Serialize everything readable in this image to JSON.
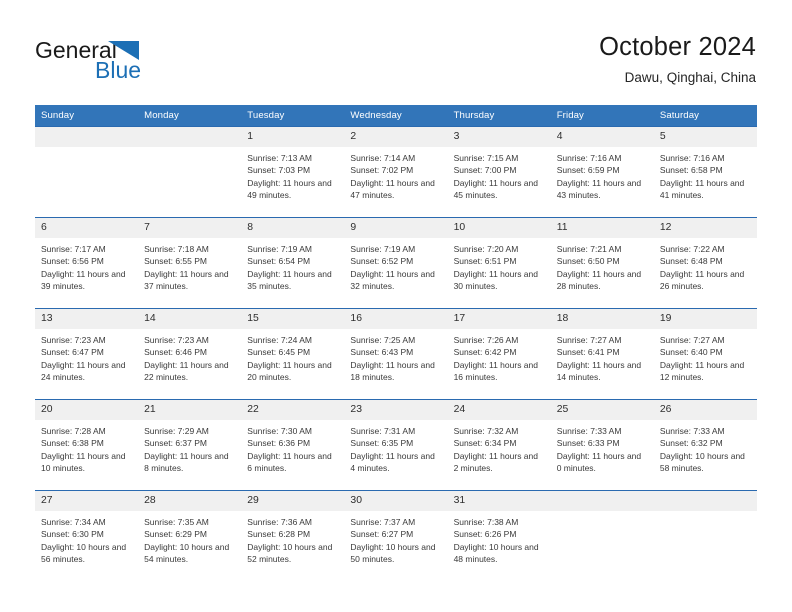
{
  "brand": {
    "name_part1": "General",
    "name_part2": "Blue",
    "logo_icon": "triangle-flag-icon",
    "color_primary": "#1c6fb5",
    "color_text": "#1a1a1a"
  },
  "header": {
    "title": "October 2024",
    "location": "Dawu, Qinghai, China"
  },
  "calendar": {
    "accent_color": "#3275b9",
    "separator_color": "#2a6ab0",
    "daynum_background": "#f0f0f0",
    "weekday_headers": [
      "Sunday",
      "Monday",
      "Tuesday",
      "Wednesday",
      "Thursday",
      "Friday",
      "Saturday"
    ],
    "weeks": [
      [
        {
          "day": "",
          "empty": true
        },
        {
          "day": "",
          "empty": true
        },
        {
          "day": "1",
          "sunrise": "Sunrise: 7:13 AM",
          "sunset": "Sunset: 7:03 PM",
          "daylight": "Daylight: 11 hours and 49 minutes."
        },
        {
          "day": "2",
          "sunrise": "Sunrise: 7:14 AM",
          "sunset": "Sunset: 7:02 PM",
          "daylight": "Daylight: 11 hours and 47 minutes."
        },
        {
          "day": "3",
          "sunrise": "Sunrise: 7:15 AM",
          "sunset": "Sunset: 7:00 PM",
          "daylight": "Daylight: 11 hours and 45 minutes."
        },
        {
          "day": "4",
          "sunrise": "Sunrise: 7:16 AM",
          "sunset": "Sunset: 6:59 PM",
          "daylight": "Daylight: 11 hours and 43 minutes."
        },
        {
          "day": "5",
          "sunrise": "Sunrise: 7:16 AM",
          "sunset": "Sunset: 6:58 PM",
          "daylight": "Daylight: 11 hours and 41 minutes."
        }
      ],
      [
        {
          "day": "6",
          "sunrise": "Sunrise: 7:17 AM",
          "sunset": "Sunset: 6:56 PM",
          "daylight": "Daylight: 11 hours and 39 minutes."
        },
        {
          "day": "7",
          "sunrise": "Sunrise: 7:18 AM",
          "sunset": "Sunset: 6:55 PM",
          "daylight": "Daylight: 11 hours and 37 minutes."
        },
        {
          "day": "8",
          "sunrise": "Sunrise: 7:19 AM",
          "sunset": "Sunset: 6:54 PM",
          "daylight": "Daylight: 11 hours and 35 minutes."
        },
        {
          "day": "9",
          "sunrise": "Sunrise: 7:19 AM",
          "sunset": "Sunset: 6:52 PM",
          "daylight": "Daylight: 11 hours and 32 minutes."
        },
        {
          "day": "10",
          "sunrise": "Sunrise: 7:20 AM",
          "sunset": "Sunset: 6:51 PM",
          "daylight": "Daylight: 11 hours and 30 minutes."
        },
        {
          "day": "11",
          "sunrise": "Sunrise: 7:21 AM",
          "sunset": "Sunset: 6:50 PM",
          "daylight": "Daylight: 11 hours and 28 minutes."
        },
        {
          "day": "12",
          "sunrise": "Sunrise: 7:22 AM",
          "sunset": "Sunset: 6:48 PM",
          "daylight": "Daylight: 11 hours and 26 minutes."
        }
      ],
      [
        {
          "day": "13",
          "sunrise": "Sunrise: 7:23 AM",
          "sunset": "Sunset: 6:47 PM",
          "daylight": "Daylight: 11 hours and 24 minutes."
        },
        {
          "day": "14",
          "sunrise": "Sunrise: 7:23 AM",
          "sunset": "Sunset: 6:46 PM",
          "daylight": "Daylight: 11 hours and 22 minutes."
        },
        {
          "day": "15",
          "sunrise": "Sunrise: 7:24 AM",
          "sunset": "Sunset: 6:45 PM",
          "daylight": "Daylight: 11 hours and 20 minutes."
        },
        {
          "day": "16",
          "sunrise": "Sunrise: 7:25 AM",
          "sunset": "Sunset: 6:43 PM",
          "daylight": "Daylight: 11 hours and 18 minutes."
        },
        {
          "day": "17",
          "sunrise": "Sunrise: 7:26 AM",
          "sunset": "Sunset: 6:42 PM",
          "daylight": "Daylight: 11 hours and 16 minutes."
        },
        {
          "day": "18",
          "sunrise": "Sunrise: 7:27 AM",
          "sunset": "Sunset: 6:41 PM",
          "daylight": "Daylight: 11 hours and 14 minutes."
        },
        {
          "day": "19",
          "sunrise": "Sunrise: 7:27 AM",
          "sunset": "Sunset: 6:40 PM",
          "daylight": "Daylight: 11 hours and 12 minutes."
        }
      ],
      [
        {
          "day": "20",
          "sunrise": "Sunrise: 7:28 AM",
          "sunset": "Sunset: 6:38 PM",
          "daylight": "Daylight: 11 hours and 10 minutes."
        },
        {
          "day": "21",
          "sunrise": "Sunrise: 7:29 AM",
          "sunset": "Sunset: 6:37 PM",
          "daylight": "Daylight: 11 hours and 8 minutes."
        },
        {
          "day": "22",
          "sunrise": "Sunrise: 7:30 AM",
          "sunset": "Sunset: 6:36 PM",
          "daylight": "Daylight: 11 hours and 6 minutes."
        },
        {
          "day": "23",
          "sunrise": "Sunrise: 7:31 AM",
          "sunset": "Sunset: 6:35 PM",
          "daylight": "Daylight: 11 hours and 4 minutes."
        },
        {
          "day": "24",
          "sunrise": "Sunrise: 7:32 AM",
          "sunset": "Sunset: 6:34 PM",
          "daylight": "Daylight: 11 hours and 2 minutes."
        },
        {
          "day": "25",
          "sunrise": "Sunrise: 7:33 AM",
          "sunset": "Sunset: 6:33 PM",
          "daylight": "Daylight: 11 hours and 0 minutes."
        },
        {
          "day": "26",
          "sunrise": "Sunrise: 7:33 AM",
          "sunset": "Sunset: 6:32 PM",
          "daylight": "Daylight: 10 hours and 58 minutes."
        }
      ],
      [
        {
          "day": "27",
          "sunrise": "Sunrise: 7:34 AM",
          "sunset": "Sunset: 6:30 PM",
          "daylight": "Daylight: 10 hours and 56 minutes."
        },
        {
          "day": "28",
          "sunrise": "Sunrise: 7:35 AM",
          "sunset": "Sunset: 6:29 PM",
          "daylight": "Daylight: 10 hours and 54 minutes."
        },
        {
          "day": "29",
          "sunrise": "Sunrise: 7:36 AM",
          "sunset": "Sunset: 6:28 PM",
          "daylight": "Daylight: 10 hours and 52 minutes."
        },
        {
          "day": "30",
          "sunrise": "Sunrise: 7:37 AM",
          "sunset": "Sunset: 6:27 PM",
          "daylight": "Daylight: 10 hours and 50 minutes."
        },
        {
          "day": "31",
          "sunrise": "Sunrise: 7:38 AM",
          "sunset": "Sunset: 6:26 PM",
          "daylight": "Daylight: 10 hours and 48 minutes."
        },
        {
          "day": "",
          "empty": true
        },
        {
          "day": "",
          "empty": true
        }
      ]
    ]
  }
}
